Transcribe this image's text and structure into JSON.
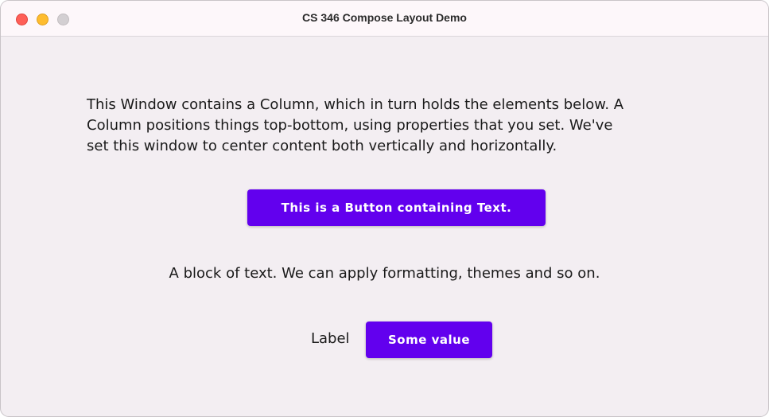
{
  "window": {
    "title": "CS 346 Compose Layout Demo"
  },
  "content": {
    "intro_text": "This Window contains a Column, which in turn holds the elements below. A\nColumn positions things top-bottom, using properties that you set. We've\nset this window to center content both vertically and horizontally.",
    "button_label": "This is a Button containing Text.",
    "block_text": "A block of text. We can apply formatting, themes and so on.",
    "label": "Label",
    "value_button_label": "Some value"
  },
  "colors": {
    "accent": "#6200ee",
    "window_background": "#f3eef2"
  }
}
